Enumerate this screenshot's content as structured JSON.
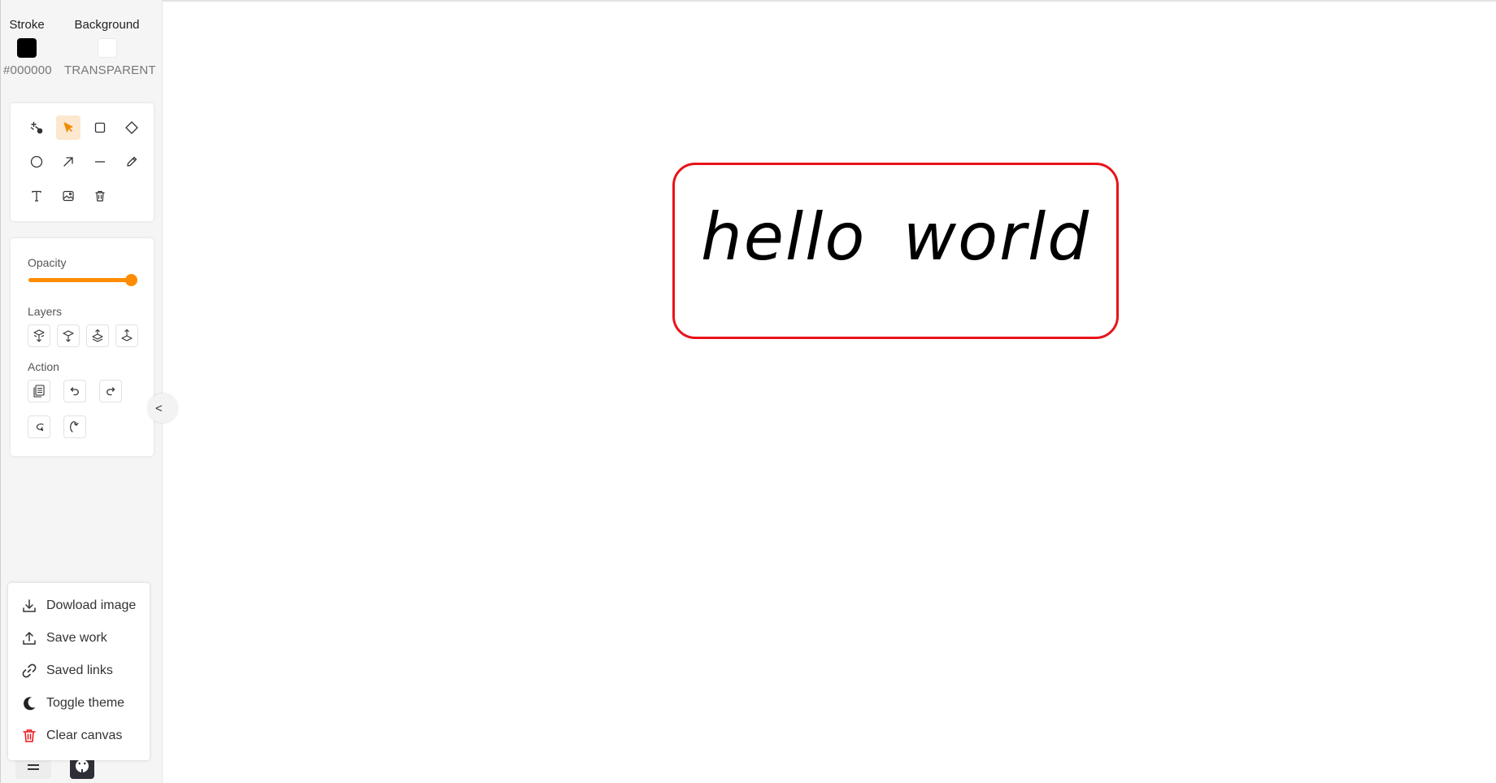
{
  "colors": {
    "stroke_label": "Stroke",
    "stroke_value": "#000000",
    "stroke_swatch": "#000000",
    "background_label": "Background",
    "background_value": "TRANSPARENT",
    "accent": "#ff8c00",
    "active_tool_bg": "#fce7cf",
    "shape_stroke": "#e8131a",
    "danger": "#e8131a"
  },
  "tools": [
    {
      "name": "laser-pointer",
      "icon": "laser-icon"
    },
    {
      "name": "select",
      "icon": "cursor-icon",
      "active": true
    },
    {
      "name": "rectangle",
      "icon": "square-icon"
    },
    {
      "name": "diamond",
      "icon": "diamond-icon"
    },
    {
      "name": "ellipse",
      "icon": "circle-icon"
    },
    {
      "name": "arrow",
      "icon": "arrow-icon"
    },
    {
      "name": "line",
      "icon": "line-icon"
    },
    {
      "name": "pencil",
      "icon": "pencil-icon"
    },
    {
      "name": "text",
      "icon": "text-icon"
    },
    {
      "name": "image",
      "icon": "image-icon"
    },
    {
      "name": "eraser",
      "icon": "trash-icon"
    }
  ],
  "properties": {
    "opacity_label": "Opacity",
    "opacity_value": 1.0,
    "layers_label": "Layers",
    "layers": [
      "send-to-back-icon",
      "send-backward-icon",
      "bring-forward-icon",
      "bring-to-front-icon"
    ],
    "action_label": "Action",
    "actions": [
      "duplicate-icon",
      "undo-icon",
      "redo-icon",
      "rotate-left-icon",
      "rotate-right-icon"
    ]
  },
  "collapse_label": "<",
  "menu": {
    "items": [
      {
        "label": "Dowload image",
        "icon": "download-icon"
      },
      {
        "label": "Save work",
        "icon": "upload-icon"
      },
      {
        "label": "Saved links",
        "icon": "link-icon"
      },
      {
        "label": "Toggle theme",
        "icon": "moon-icon"
      },
      {
        "label": "Clear canvas",
        "icon": "trash-icon"
      }
    ]
  },
  "canvas": {
    "shape_text": "hello world"
  }
}
